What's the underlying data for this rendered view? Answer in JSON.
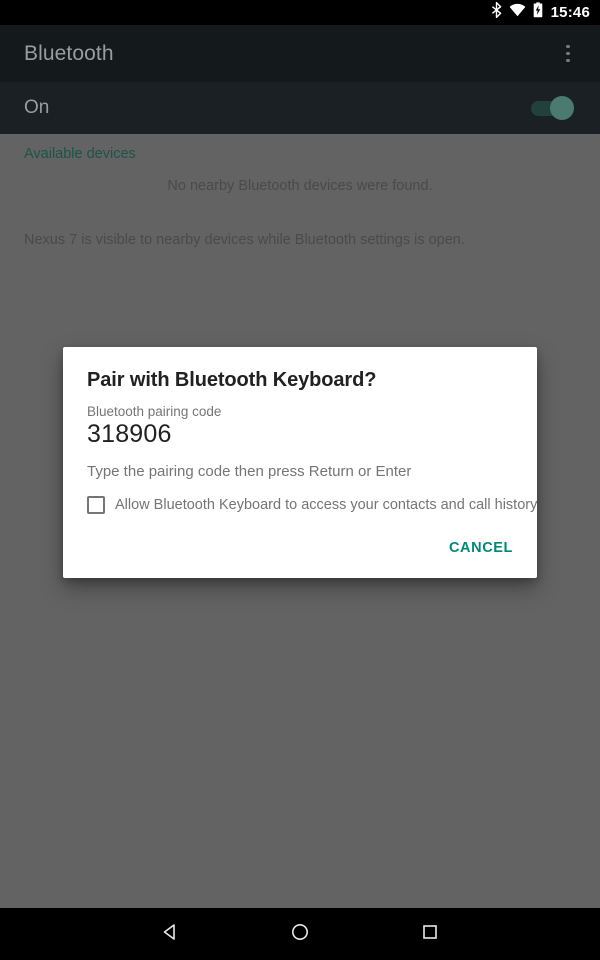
{
  "status_bar": {
    "icons": [
      "bluetooth-icon",
      "wifi-icon",
      "battery-charging-icon"
    ],
    "clock": "15:46"
  },
  "app_bar": {
    "title": "Bluetooth",
    "overflow_icon": "overflow-menu-icon"
  },
  "switch_row": {
    "state_label": "On",
    "toggle_on": true,
    "toggle_color": "#4b7a6f"
  },
  "content": {
    "available_devices_header": "Available devices",
    "no_devices_text": "No nearby Bluetooth devices were found.",
    "visibility_text": "Nexus 7 is visible to nearby devices while Bluetooth settings is open."
  },
  "dialog": {
    "title": "Pair with Bluetooth Keyboard?",
    "pairing_code_label": "Bluetooth pairing code",
    "pairing_code_value": "318906",
    "instruction": "Type the pairing code then press Return or Enter",
    "checkbox_label": "Allow Bluetooth Keyboard to access your contacts and call history",
    "checkbox_checked": false,
    "cancel_label": "CANCEL"
  },
  "nav_bar": {
    "back_icon": "back-triangle-icon",
    "home_icon": "home-circle-icon",
    "recents_icon": "recents-square-icon"
  },
  "colors": {
    "accent_teal": "#00897b",
    "header_teal": "#1c5448",
    "app_bar_bg": "#141A1C",
    "switch_row_bg": "#1A2024",
    "scrim": "#636363"
  }
}
